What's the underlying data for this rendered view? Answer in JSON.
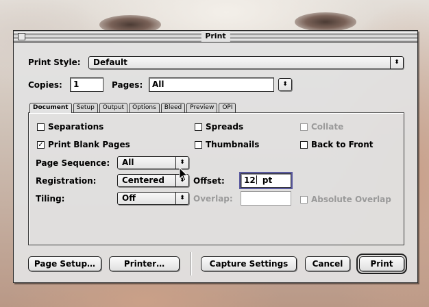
{
  "window": {
    "title": "Print"
  },
  "print_style": {
    "label": "Print Style:",
    "value": "Default"
  },
  "copies": {
    "label": "Copies:",
    "value": "1"
  },
  "pages": {
    "label": "Pages:",
    "value": "All"
  },
  "tabs": [
    {
      "label": "Document",
      "active": true
    },
    {
      "label": "Setup"
    },
    {
      "label": "Output"
    },
    {
      "label": "Options"
    },
    {
      "label": "Bleed"
    },
    {
      "label": "Preview"
    },
    {
      "label": "OPI"
    }
  ],
  "document": {
    "separations": {
      "label": "Separations",
      "checked": false
    },
    "spreads": {
      "label": "Spreads",
      "checked": false
    },
    "collate": {
      "label": "Collate",
      "checked": false,
      "enabled": false
    },
    "print_blank_pages": {
      "label": "Print Blank Pages",
      "checked": true
    },
    "thumbnails": {
      "label": "Thumbnails",
      "checked": false
    },
    "back_to_front": {
      "label": "Back to Front",
      "checked": false
    },
    "page_sequence": {
      "label": "Page Sequence:",
      "value": "All"
    },
    "registration": {
      "label": "Registration:",
      "value": "Centered"
    },
    "offset": {
      "label": "Offset:",
      "value": "12",
      "unit": "pt"
    },
    "tiling": {
      "label": "Tiling:",
      "value": "Off"
    },
    "overlap": {
      "label": "Overlap:",
      "value": "",
      "enabled": false
    },
    "absolute_overlap": {
      "label": "Absolute Overlap",
      "checked": false,
      "enabled": false
    }
  },
  "buttons": {
    "page_setup": "Page Setup…",
    "printer": "Printer…",
    "capture_settings": "Capture Settings",
    "cancel": "Cancel",
    "print": "Print"
  },
  "icons": {
    "popup_arrows": "⬍",
    "check_mark": "✓"
  },
  "colors": {
    "window_bg": "#e2e2e2",
    "disabled_text": "#9a9a9a",
    "focus_ring": "#5a5aa0"
  }
}
